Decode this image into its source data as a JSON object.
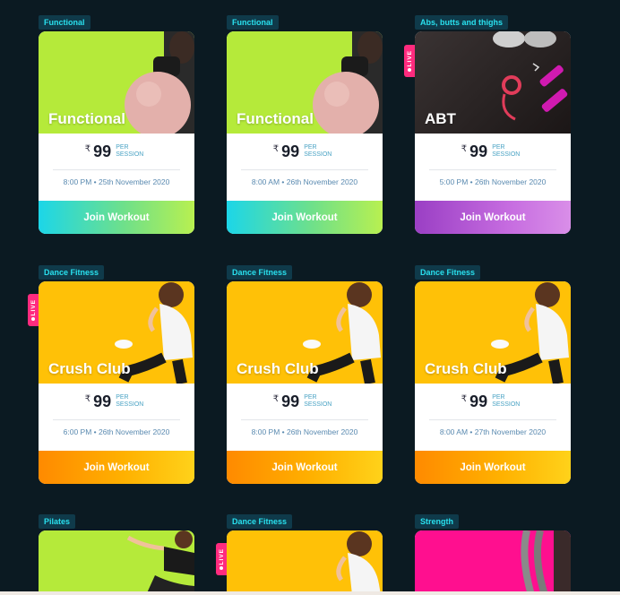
{
  "join_label": "Join Workout",
  "per_label": "PER SESSION",
  "currency": "₹",
  "live_label": "LIVE",
  "cards": [
    {
      "category": "Functional",
      "title": "Functional",
      "price": "99",
      "time": "8:00 PM • 25th November 2020",
      "illustration": "exercise-ball",
      "live": false
    },
    {
      "category": "Functional",
      "title": "Functional",
      "price": "99",
      "time": "8:00 AM • 26th November 2020",
      "illustration": "exercise-ball",
      "live": false
    },
    {
      "category": "Abs, butts and thighs",
      "title": "ABT",
      "price": "99",
      "time": "5:00 PM • 26th November 2020",
      "illustration": "dumbbells",
      "live": true
    },
    {
      "category": "Dance Fitness",
      "title": "Crush Club",
      "price": "99",
      "time": "6:00 PM • 26th November 2020",
      "illustration": "dancer",
      "live": true
    },
    {
      "category": "Dance Fitness",
      "title": "Crush Club",
      "price": "99",
      "time": "8:00 PM • 26th November 2020",
      "illustration": "dancer",
      "live": false
    },
    {
      "category": "Dance Fitness",
      "title": "Crush Club",
      "price": "99",
      "time": "8:00 AM • 27th November 2020",
      "illustration": "dancer",
      "live": false
    },
    {
      "category": "Pilates",
      "illustration": "pilates-woman",
      "live": false
    },
    {
      "category": "Dance Fitness",
      "illustration": "dancer",
      "live": true
    },
    {
      "category": "Strength",
      "illustration": "battle-ropes",
      "live": false
    }
  ],
  "colors": {
    "background": "#0b1a22",
    "category_tag_text": "#29e0ee",
    "live_badge": "#ff2b7e"
  }
}
